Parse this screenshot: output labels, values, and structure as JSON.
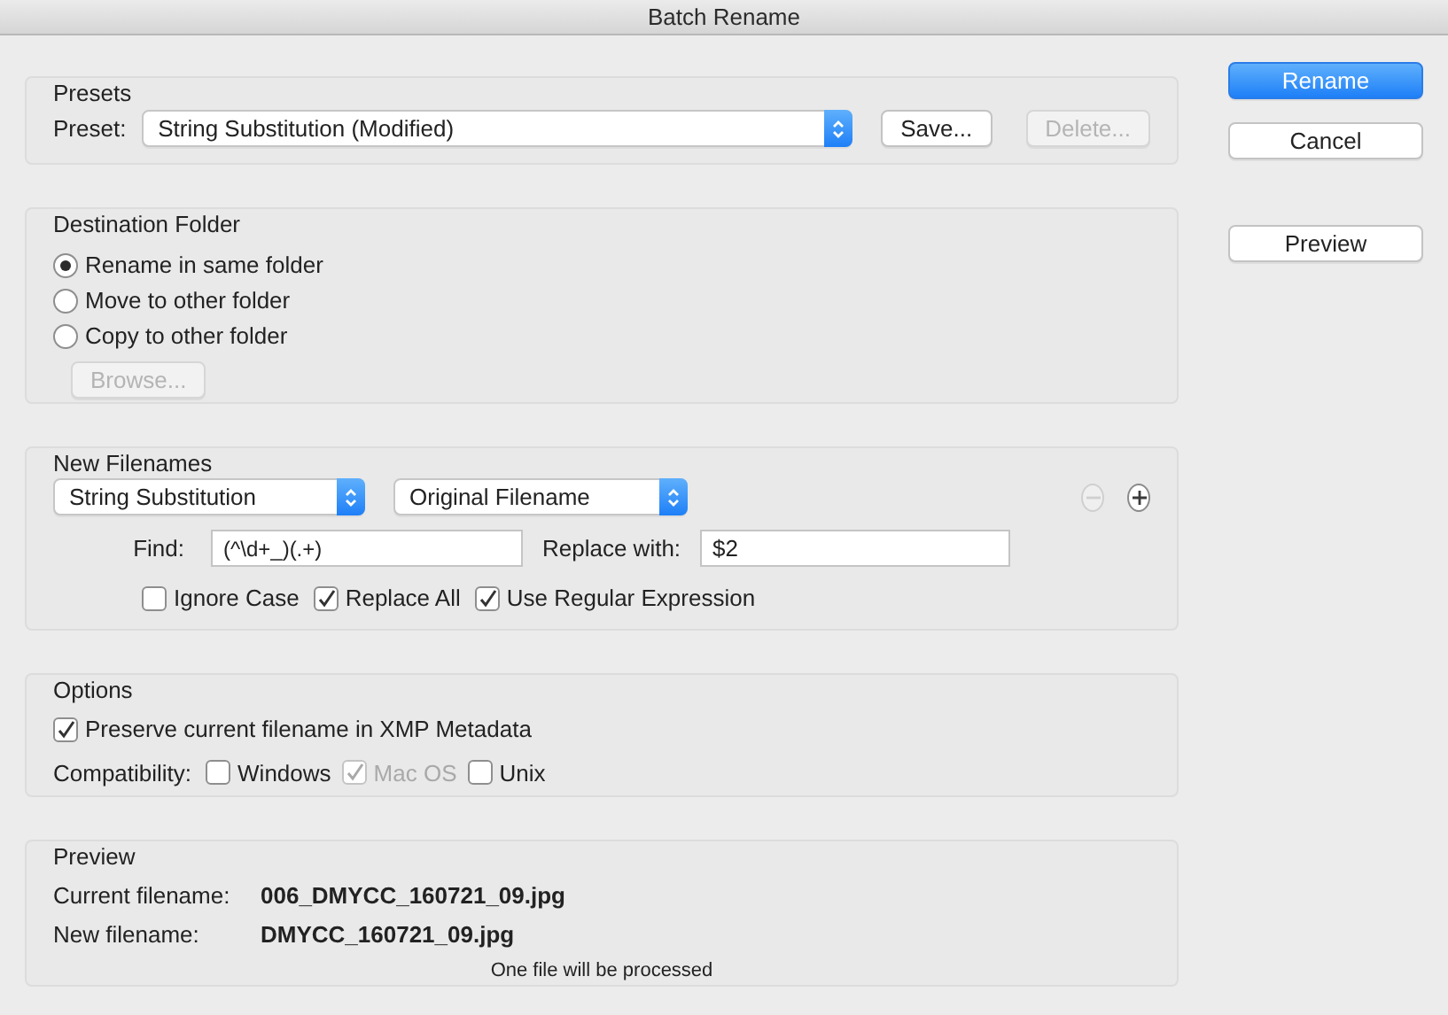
{
  "window": {
    "title": "Batch Rename"
  },
  "presets": {
    "heading": "Presets",
    "label": "Preset:",
    "value": "String Substitution (Modified)",
    "buttons": [
      {
        "label": "Save...",
        "disabled": false
      },
      {
        "label": "Delete...",
        "disabled": true
      }
    ]
  },
  "destination": {
    "heading": "Destination Folder",
    "options": [
      {
        "label": "Rename in same folder",
        "selected": true
      },
      {
        "label": "Move to other folder",
        "selected": false
      },
      {
        "label": "Copy to other folder",
        "selected": false
      }
    ],
    "browse": {
      "label": "Browse...",
      "disabled": true
    }
  },
  "new_filenames": {
    "heading": "New Filenames",
    "method": "String Substitution",
    "source": "Original Filename",
    "remove_button": {
      "disabled": true
    },
    "add_button": {
      "disabled": false
    },
    "find": {
      "label": "Find:",
      "value": "(^\\d+_)(.+)"
    },
    "replace": {
      "label": "Replace with:",
      "value": "$2"
    },
    "checks": [
      {
        "label": "Ignore Case",
        "checked": false
      },
      {
        "label": "Replace All",
        "checked": true
      },
      {
        "label": "Use Regular Expression",
        "checked": true
      }
    ]
  },
  "options": {
    "heading": "Options",
    "preserve": {
      "label": "Preserve current filename in XMP Metadata",
      "checked": true
    },
    "compatibility_label": "Compatibility:",
    "compatibility": [
      {
        "label": "Windows",
        "checked": false,
        "disabled": false
      },
      {
        "label": "Mac OS",
        "checked": true,
        "disabled": true
      },
      {
        "label": "Unix",
        "checked": false,
        "disabled": false
      }
    ]
  },
  "preview": {
    "heading": "Preview",
    "current_label": "Current filename:",
    "current_value": "006_DMYCC_160721_09.jpg",
    "new_label": "New filename:",
    "new_value": "DMYCC_160721_09.jpg",
    "status": "One file will be processed"
  },
  "actions": [
    {
      "label": "Rename",
      "kind": "default"
    },
    {
      "label": "Cancel",
      "kind": "normal"
    }
  ],
  "preview_button": {
    "label": "Preview"
  }
}
